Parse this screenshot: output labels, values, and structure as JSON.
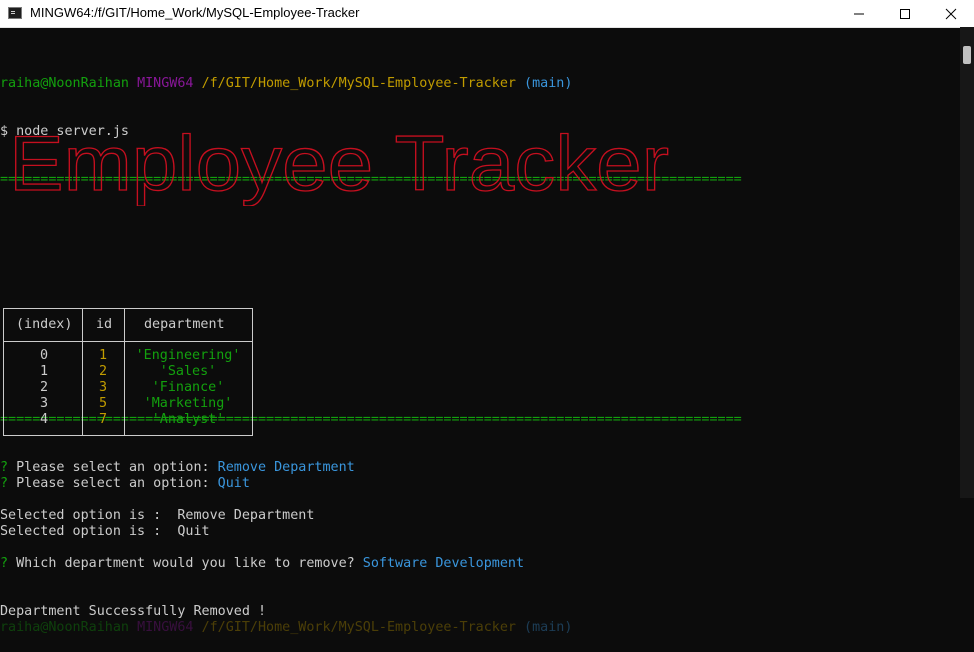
{
  "window": {
    "title": "MINGW64:/f/GIT/Home_Work/MySQL-Employee-Tracker"
  },
  "prompt": {
    "user_host": "raiha@NoonRaihan",
    "shell": "MINGW64",
    "path": "/f/GIT/Home_Work/MySQL-Employee-Tracker",
    "branch": "(main)"
  },
  "command": "$ node server.js",
  "separator": "============================================================================================",
  "banner_text": "Employee Tracker",
  "session": {
    "q1_prefix": "?",
    "q1_text": "Please select an option:",
    "q1_answer": "Remove Department",
    "selected1": "Selected option is :  Remove Department",
    "q2_prefix": "?",
    "q2_text": "Which department would you like to remove?",
    "q2_answer": "Software Development",
    "success": "Department Successfully Removed !",
    "q3_prefix": "?",
    "q3_text": "Please select an option:",
    "q3_answer": "Quit",
    "selected2": "Selected option is :  Quit"
  },
  "table": {
    "headers": [
      "(index)",
      "id",
      "department"
    ],
    "rows": [
      {
        "index": "0",
        "id": "1",
        "department": "'Engineering'"
      },
      {
        "index": "1",
        "id": "2",
        "department": "'Sales'"
      },
      {
        "index": "2",
        "id": "3",
        "department": "'Finance'"
      },
      {
        "index": "3",
        "id": "5",
        "department": "'Marketing'"
      },
      {
        "index": "4",
        "id": "7",
        "department": "'Analyst'"
      }
    ]
  },
  "colors": {
    "green": "#13a10e",
    "magenta": "#881798",
    "yellow": "#c19c00",
    "cyan": "#3a96dd",
    "red": "#c50f1f",
    "text": "#cccccc",
    "background": "#0c0c0c"
  }
}
